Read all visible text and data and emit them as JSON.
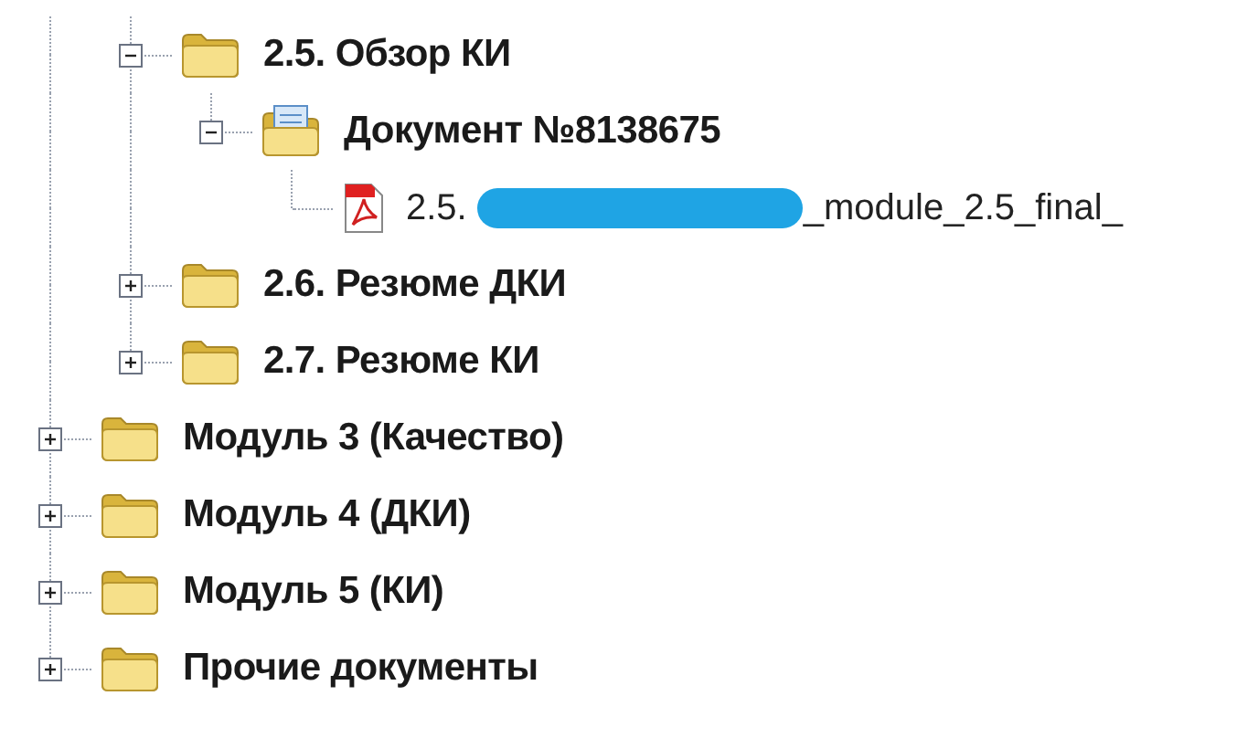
{
  "tree": [
    {
      "children": [
        {
          "kind": "folder",
          "label": "2.5. Обзор КИ",
          "expanded": true,
          "children": [
            {
              "kind": "document",
              "label": "Документ №8138675",
              "expanded": true,
              "children": [
                {
                  "kind": "pdf",
                  "label_start": "2.5.",
                  "redacted": true,
                  "label_end": "_module_2.5_final_"
                }
              ]
            }
          ]
        },
        {
          "kind": "folder",
          "label": "2.6. Резюме ДКИ",
          "expanded": false
        },
        {
          "kind": "folder",
          "label": "2.7. Резюме КИ",
          "expanded": false
        }
      ]
    },
    {
      "kind": "folder",
      "label": "Модуль 3 (Качество)",
      "expanded": false
    },
    {
      "kind": "folder",
      "label": "Модуль 4 (ДКИ)",
      "expanded": false
    },
    {
      "kind": "folder",
      "label": "Модуль 5 (КИ)",
      "expanded": false
    },
    {
      "kind": "folder",
      "label": "Прочие документы",
      "expanded": false
    }
  ]
}
